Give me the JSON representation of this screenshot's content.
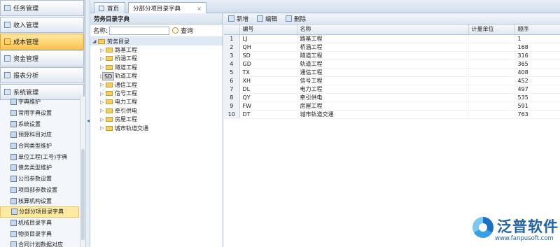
{
  "nav": {
    "sections": [
      {
        "label": "任务管理",
        "active": false
      },
      {
        "label": "收入管理",
        "active": false
      },
      {
        "label": "成本管理",
        "active": true
      },
      {
        "label": "资金管理",
        "active": false
      },
      {
        "label": "报表分析",
        "active": false
      },
      {
        "label": "系统管理",
        "active": false
      }
    ],
    "sub_items": [
      {
        "label": "字典维护"
      },
      {
        "label": "常用字典设置"
      },
      {
        "label": "系统设置"
      },
      {
        "label": "预算科目对应"
      },
      {
        "label": "合同类型维护"
      },
      {
        "label": "单位工程(工号)字典"
      },
      {
        "label": "债务类型维护"
      },
      {
        "label": "公司参数设置"
      },
      {
        "label": "项目部参数设置"
      },
      {
        "label": "核算机构设置"
      },
      {
        "label": "分部分项目录字典"
      },
      {
        "label": "机械目录字典"
      },
      {
        "label": "物资目录字典"
      },
      {
        "label": "合同计划数据对应"
      }
    ]
  },
  "tabs": [
    {
      "label": "首页"
    },
    {
      "label": "分部分项目录字典",
      "close": "×"
    }
  ],
  "tree": {
    "title": "劳务目录字典",
    "search_label": "名称:",
    "search_button": "查询",
    "root_label": "劳务目录",
    "tooltip": "SD",
    "nodes": [
      {
        "label": "路基工程"
      },
      {
        "label": "桥涵工程"
      },
      {
        "label": "隧道工程"
      },
      {
        "label": "轨道工程"
      },
      {
        "label": "通信工程"
      },
      {
        "label": "信号工程"
      },
      {
        "label": "电力工程"
      },
      {
        "label": "牵引供电"
      },
      {
        "label": "房屋工程"
      },
      {
        "label": "城市轨道交通"
      }
    ]
  },
  "toolbar": {
    "add": "新增",
    "edit": "编辑",
    "delete": "删除"
  },
  "table": {
    "headers": [
      "",
      "编号",
      "名称",
      "计量单位",
      "顺序"
    ],
    "rows": [
      {
        "n": "1",
        "code": "LJ",
        "name": "路基工程",
        "unit": "",
        "order": "1"
      },
      {
        "n": "2",
        "code": "QH",
        "name": "桥涵工程",
        "unit": "",
        "order": "168"
      },
      {
        "n": "3",
        "code": "SD",
        "name": "隧道工程",
        "unit": "",
        "order": "316"
      },
      {
        "n": "4",
        "code": "GD",
        "name": "轨道工程",
        "unit": "",
        "order": "365"
      },
      {
        "n": "5",
        "code": "TX",
        "name": "通信工程",
        "unit": "",
        "order": "408"
      },
      {
        "n": "6",
        "code": "XH",
        "name": "信号工程",
        "unit": "",
        "order": "452"
      },
      {
        "n": "7",
        "code": "DL",
        "name": "电力工程",
        "unit": "",
        "order": "497"
      },
      {
        "n": "8",
        "code": "QY",
        "name": "牵引供电",
        "unit": "",
        "order": "535"
      },
      {
        "n": "9",
        "code": "FW",
        "name": "房屋工程",
        "unit": "",
        "order": "591"
      },
      {
        "n": "10",
        "code": "DT",
        "name": "城市轨道交通",
        "unit": "",
        "order": "763"
      }
    ]
  },
  "logo": {
    "name": "泛普软件",
    "url": "www.fanpusoft.com"
  }
}
